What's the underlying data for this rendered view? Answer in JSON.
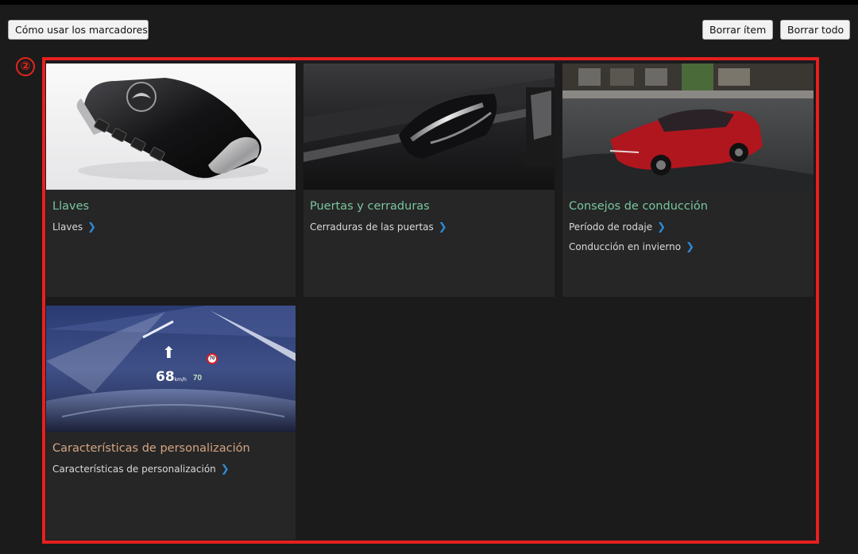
{
  "toolbar": {
    "how_to_label": "Cómo usar los marcadores",
    "delete_item_label": "Borrar ítem",
    "delete_all_label": "Borrar todo"
  },
  "annotation": {
    "marker": "②",
    "color": "#e81f1f"
  },
  "cards": [
    {
      "title": "Llaves",
      "image": "key-fob-image",
      "links": [
        "Llaves"
      ]
    },
    {
      "title": "Puertas y cerraduras",
      "image": "door-handle-image",
      "links": [
        "Cerraduras de las puertas"
      ]
    },
    {
      "title": "Consejos de conducción",
      "image": "red-suv-image",
      "links": [
        "Período de rodaje",
        "Conducción en invierno"
      ]
    },
    {
      "title": "Características de personalización",
      "image": "head-up-display-image",
      "links": [
        "Características de personalización"
      ],
      "hud": {
        "speed": "68",
        "unit": "km/h",
        "limit": "70"
      }
    }
  ],
  "colors": {
    "title_green": "#79c69d",
    "title_orange": "#d6a581",
    "chevron_blue": "#2f8bd8",
    "card_bg": "#262627"
  }
}
